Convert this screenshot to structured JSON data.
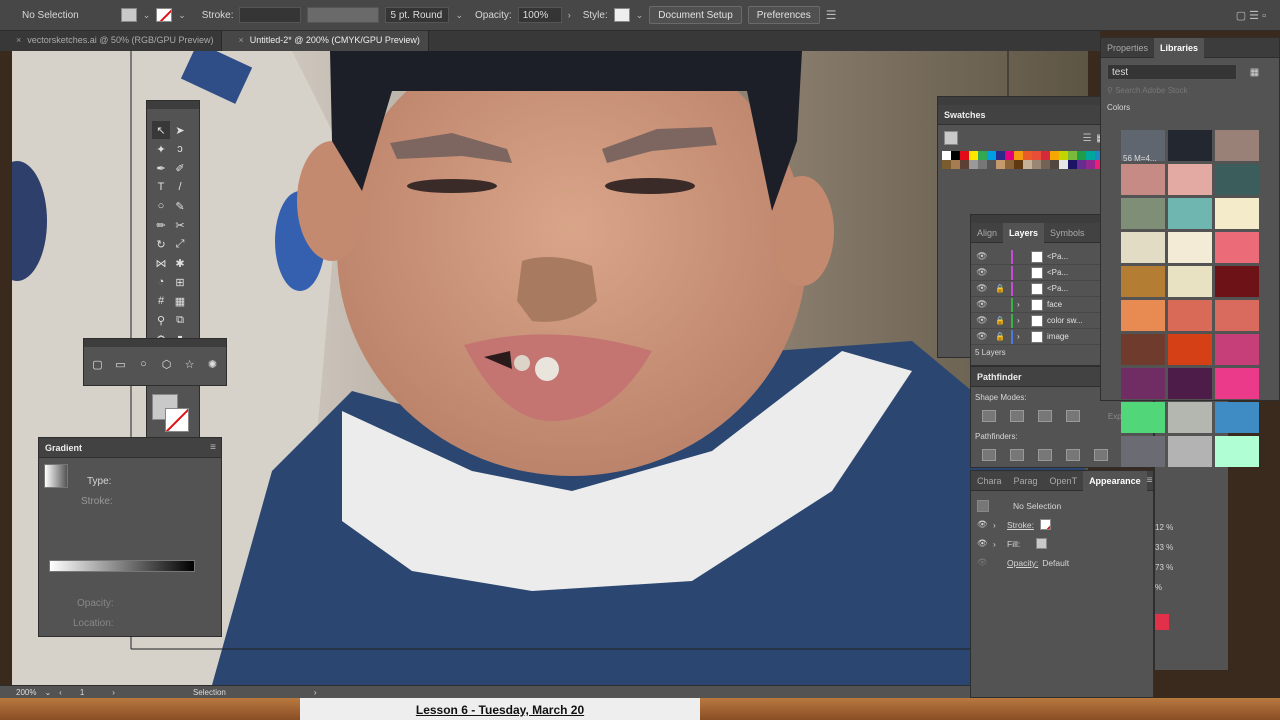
{
  "control_bar": {
    "selection": "No Selection",
    "stroke_label": "Stroke:",
    "brush": "5 pt. Round",
    "opacity_label": "Opacity:",
    "opacity_value": "100%",
    "style_label": "Style:",
    "document_setup": "Document Setup",
    "preferences": "Preferences"
  },
  "tabs": [
    {
      "label": "vectorsketches.ai @ 50% (RGB/GPU Preview)"
    },
    {
      "label": "Untitled-2* @ 200% (CMYK/GPU Preview)"
    }
  ],
  "status_bar": {
    "zoom": "200%",
    "artboard": "1",
    "tool": "Selection"
  },
  "gradient_panel": {
    "title": "Gradient",
    "type_label": "Type:",
    "stroke_label": "Stroke:",
    "opacity_label": "Opacity:",
    "location_label": "Location:"
  },
  "swatches_panel": {
    "title": "Swatches"
  },
  "layers_panel": {
    "tabs": [
      "Align",
      "Layers",
      "Symbols"
    ],
    "rows": [
      {
        "name": "<Pa...",
        "locked": false,
        "bar": "#c84ad8"
      },
      {
        "name": "<Pa...",
        "locked": false,
        "bar": "#c84ad8"
      },
      {
        "name": "<Pa...",
        "locked": true,
        "bar": "#c84ad8"
      },
      {
        "name": "face",
        "locked": false,
        "bar": "#33b547"
      },
      {
        "name": "color sw...",
        "locked": true,
        "bar": "#33b547"
      },
      {
        "name": "image",
        "locked": true,
        "bar": "#4a7ae0"
      }
    ],
    "count": "5 Layers"
  },
  "pathfinder_panel": {
    "title": "Pathfinder",
    "shape_modes": "Shape Modes:",
    "pathfinders": "Pathfinders:",
    "expand": "Expand"
  },
  "appearance_panel": {
    "tabs": [
      "Chara",
      "Parag",
      "OpenT",
      "Appearance"
    ],
    "selection": "No Selection",
    "stroke": "Stroke:",
    "fill": "Fill:",
    "opacity": "Opacity:",
    "opacity_value": "Default",
    "side_values": [
      "12 %",
      "33 %",
      "73 %",
      "%"
    ]
  },
  "right_panel": {
    "tabs": [
      "Properties",
      "Libraries"
    ],
    "library": "test",
    "search_placeholder": "Search Adobe Stock",
    "colors_label": "Colors",
    "swatch_label": "56 M=4..."
  },
  "lesson_banner": "Lesson 6 - Tuesday, March 20",
  "colors": {
    "lib_swatches": [
      "#5f6670",
      "#222730",
      "#9a8178",
      "#c78b85",
      "#e3a9a3",
      "#3b5d5c",
      "#7f8f77",
      "#6fb5b0",
      "#f4ebca",
      "#e2dcc4",
      "#f4ebd7",
      "#ec6b78",
      "#b37e33",
      "#e9e2c2",
      "#6d1216",
      "#e88b52",
      "#d96a57",
      "#d86b5e",
      "#6e3b2d",
      "#d64016",
      "#c63f78",
      "#6f2d63",
      "#4e1c49",
      "#ec3a8b",
      "#51d77a",
      "#b4b7b0",
      "#3f8cc4",
      "#6b6c73",
      "#b3b3b3",
      "#b0ffd4"
    ]
  }
}
